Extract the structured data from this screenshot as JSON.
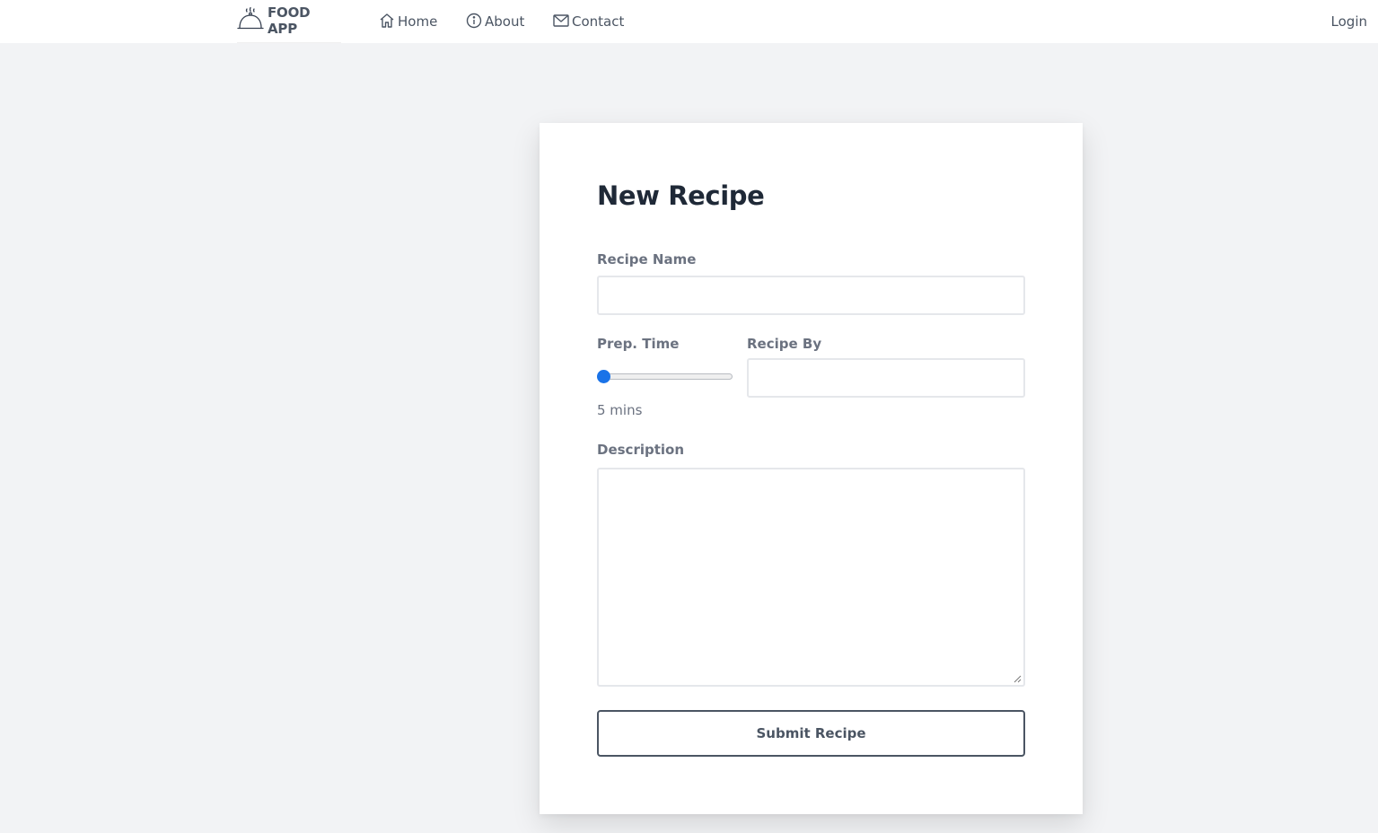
{
  "nav": {
    "brand": "FOOD APP",
    "brand_icon": "cloche-icon",
    "links": [
      {
        "label": "Home",
        "icon": "home-icon"
      },
      {
        "label": "About",
        "icon": "info-icon"
      },
      {
        "label": "Contact",
        "icon": "mail-icon"
      }
    ],
    "login": "Login"
  },
  "form": {
    "title": "New Recipe",
    "recipe_name": {
      "label": "Recipe Name",
      "value": "",
      "placeholder": ""
    },
    "prep_time": {
      "label": "Prep. Time",
      "value": 5,
      "display": "5 mins"
    },
    "recipe_by": {
      "label": "Recipe By",
      "value": "",
      "placeholder": ""
    },
    "description": {
      "label": "Description",
      "value": "",
      "placeholder": ""
    },
    "submit_label": "Submit Recipe"
  },
  "colors": {
    "accent": "#1a73e8",
    "background": "#f2f3f5",
    "text": "#4b5563",
    "heading": "#1f2937"
  }
}
